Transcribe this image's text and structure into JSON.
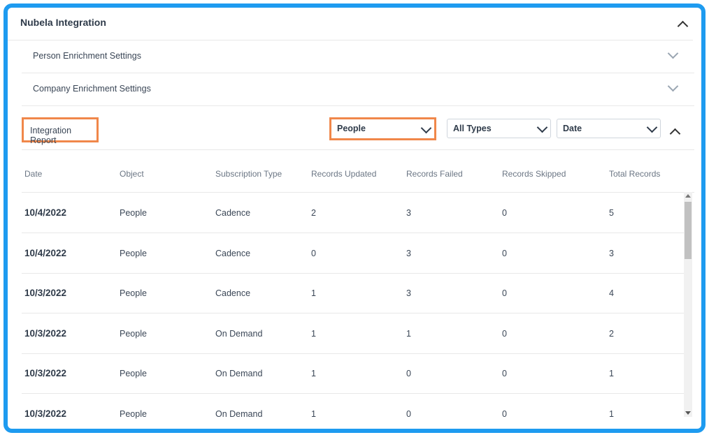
{
  "panel": {
    "title": "Nubela Integration"
  },
  "sections": [
    {
      "label": "Person Enrichment Settings"
    },
    {
      "label": "Company Enrichment Settings"
    }
  ],
  "report": {
    "label": "Integration Report",
    "filters": {
      "object": "People",
      "type": "All Types",
      "sort": "Date"
    }
  },
  "table": {
    "headers": [
      "Date",
      "Object",
      "Subscription Type",
      "Records Updated",
      "Records Failed",
      "Records Skipped",
      "Total Records"
    ],
    "rows": [
      [
        "10/4/2022",
        "People",
        "Cadence",
        "2",
        "3",
        "0",
        "5"
      ],
      [
        "10/4/2022",
        "People",
        "Cadence",
        "0",
        "3",
        "0",
        "3"
      ],
      [
        "10/3/2022",
        "People",
        "Cadence",
        "1",
        "3",
        "0",
        "4"
      ],
      [
        "10/3/2022",
        "People",
        "On Demand",
        "1",
        "1",
        "0",
        "2"
      ],
      [
        "10/3/2022",
        "People",
        "On Demand",
        "1",
        "0",
        "0",
        "1"
      ],
      [
        "10/3/2022",
        "People",
        "On Demand",
        "1",
        "0",
        "0",
        "1"
      ]
    ]
  },
  "colors": {
    "frame": "#1e9bf0",
    "highlight": "#f0874a"
  },
  "icons": {
    "collapse": "chevron-up-icon",
    "expand": "chevron-down-icon"
  }
}
